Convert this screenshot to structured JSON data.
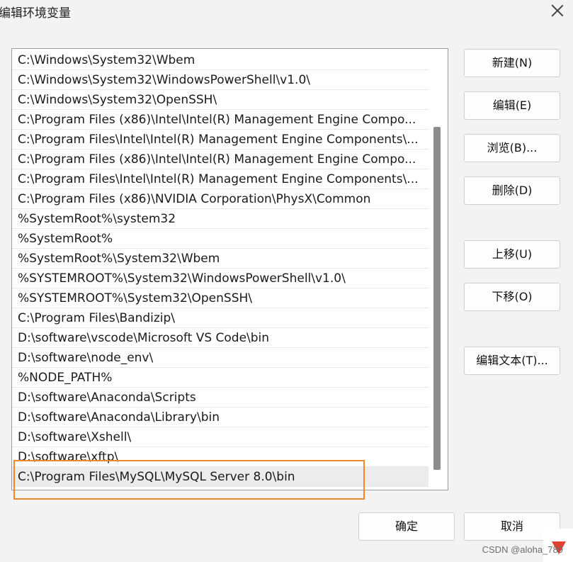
{
  "window": {
    "title": "编辑环境变量"
  },
  "path_list": {
    "entries": [
      "C:\\Windows\\System32\\Wbem",
      "C:\\Windows\\System32\\WindowsPowerShell\\v1.0\\",
      "C:\\Windows\\System32\\OpenSSH\\",
      "C:\\Program Files (x86)\\Intel\\Intel(R) Management Engine Compo...",
      "C:\\Program Files\\Intel\\Intel(R) Management Engine Components\\...",
      "C:\\Program Files (x86)\\Intel\\Intel(R) Management Engine Compo...",
      "C:\\Program Files\\Intel\\Intel(R) Management Engine Components\\...",
      "C:\\Program Files (x86)\\NVIDIA Corporation\\PhysX\\Common",
      "%SystemRoot%\\system32",
      "%SystemRoot%",
      "%SystemRoot%\\System32\\Wbem",
      "%SYSTEMROOT%\\System32\\WindowsPowerShell\\v1.0\\",
      "%SYSTEMROOT%\\System32\\OpenSSH\\",
      "C:\\Program Files\\Bandizip\\",
      "D:\\software\\vscode\\Microsoft VS Code\\bin",
      "D:\\software\\node_env\\",
      "%NODE_PATH%",
      "D:\\software\\Anaconda\\Scripts",
      "D:\\software\\Anaconda\\Library\\bin",
      "D:\\software\\Xshell\\",
      "D:\\software\\xftp\\",
      "C:\\Program Files\\MySQL\\MySQL Server 8.0\\bin"
    ],
    "selected_index": 21
  },
  "buttons": {
    "new": "新建(N)",
    "edit": "编辑(E)",
    "browse": "浏览(B)...",
    "delete": "删除(D)",
    "move_up": "上移(U)",
    "move_down": "下移(O)",
    "edit_text": "编辑文本(T)...",
    "ok": "确定",
    "cancel": "取消"
  },
  "watermark": "CSDN @aloha_789",
  "colors": {
    "highlight_border": "#f0892c",
    "selected_row": "#ececec"
  }
}
